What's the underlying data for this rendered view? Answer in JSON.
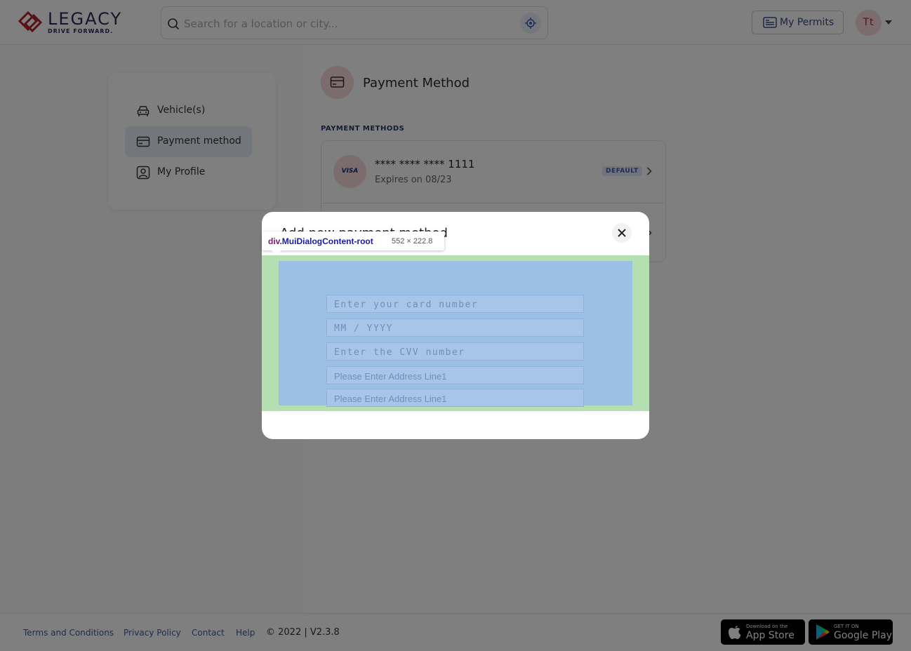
{
  "header": {
    "logo_word": "LEGACY",
    "logo_tagline": "DRIVE FORWARD.",
    "search_placeholder": "Search for a location or city...",
    "permits_label": "My Permits",
    "avatar_initials": "Tt"
  },
  "sidebar": {
    "items": [
      {
        "label": "Vehicle(s)",
        "icon": "car-icon",
        "active": false
      },
      {
        "label": "Payment method",
        "icon": "credit-card-icon",
        "active": true
      },
      {
        "label": "My Profile",
        "icon": "profile-icon",
        "active": false
      }
    ]
  },
  "main": {
    "title": "Payment Method",
    "section_label": "PAYMENT METHODS",
    "cards": [
      {
        "brand": "VISA",
        "number": "**** **** **** 1111",
        "expiry": "Expires on 08/23",
        "badge": "DEFAULT"
      }
    ]
  },
  "dialog": {
    "title": "Add new payment method",
    "fields": [
      {
        "placeholder": "Enter your card number"
      },
      {
        "placeholder": "MM / YYYY"
      },
      {
        "placeholder": "Enter the CVV number"
      },
      {
        "placeholder": "Please Enter Address Line1"
      },
      {
        "placeholder": "Please Enter Address Line1"
      }
    ]
  },
  "devtools_tooltip": {
    "tag": "div",
    "class_name": ".MuiDialogContent-root",
    "size": "552 × 222.8"
  },
  "footer": {
    "links": [
      "Terms and Conditions",
      "Privacy Policy",
      "Contact",
      "Help"
    ],
    "copyright": "© 2022 | V2.3.8",
    "app_store_small": "Download on the",
    "app_store_big": "App Store",
    "play_store_small": "GET IT ON",
    "play_store_big": "Google Play"
  },
  "colors": {
    "brand_red": "#b0232e",
    "brand_navy": "#2a2a5a",
    "link_blue": "#3a5aaa",
    "content_highlight": "#9cbfe6",
    "padding_highlight": "#b4dfb0"
  }
}
